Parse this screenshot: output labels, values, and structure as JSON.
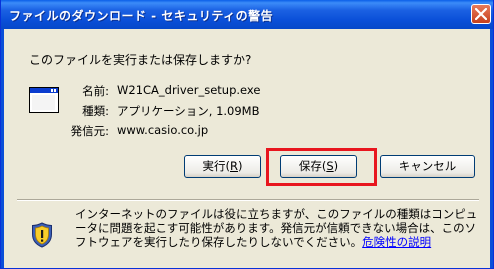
{
  "window": {
    "title": "ファイルのダウンロード - セキュリティの警告"
  },
  "prompt": "このファイルを実行または保存しますか?",
  "file": {
    "name_label": "名前:",
    "name_value": "W21CA_driver_setup.exe",
    "type_label": "種類:",
    "type_value": "アプリケーション, 1.09MB",
    "publisher_label": "発信元:",
    "publisher_value": "www.casio.co.jp",
    "icon": "application-window-icon"
  },
  "buttons": {
    "run": {
      "label": "実行(",
      "key": "R",
      "suffix": ")"
    },
    "save": {
      "label": "保存(",
      "key": "S",
      "suffix": ")"
    },
    "cancel": {
      "label": "キャンセル"
    }
  },
  "warning": {
    "icon": "security-shield-icon",
    "text": "インターネットのファイルは役に立ちますが、このファイルの種類はコンピュータに問題を起こす可能性があります。発信元が信頼できない場合は、このソフトウェアを実行したり保存したりしないでください。",
    "link": "危険性の説明"
  },
  "colors": {
    "titlebar": "#0a4fd8",
    "highlight": "#e8161e",
    "link": "#0000ff"
  }
}
